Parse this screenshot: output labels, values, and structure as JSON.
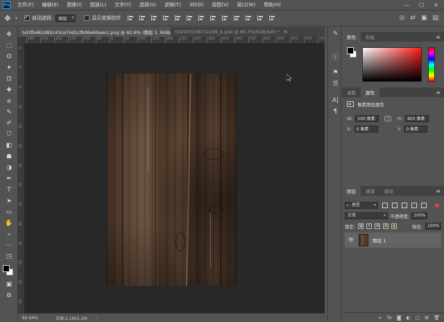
{
  "app": {
    "logo_text": "Ps"
  },
  "menu": {
    "items": [
      "文件(F)",
      "编辑(E)",
      "图像(I)",
      "图层(L)",
      "文字(Y)",
      "选择(S)",
      "滤镜(T)",
      "3D(D)",
      "视图(V)",
      "窗口(W)",
      "帮助(H)"
    ],
    "window_controls": [
      "—",
      "☐",
      "✕"
    ]
  },
  "options_bar": {
    "auto_select_label": "自动选择:",
    "auto_select_checked": true,
    "auto_select_target": "图层",
    "transform_controls_label": "显示变换控件",
    "transform_controls_checked": false,
    "right_icons": [
      "◎",
      "⇄",
      "▣",
      "▤"
    ]
  },
  "tabs": [
    {
      "label": "bd3fb482d82c43ce74d1cfb06e69aecc.png @ 82.6% (图层 1, RGB/8)",
      "close": "×",
      "active": true
    },
    {
      "label": "002003038732288_b.psd @ 66.7%(RGB/8#) *",
      "close": "×",
      "active": false
    }
  ],
  "rulers": {
    "h_ticks": [
      "300",
      "250",
      "200",
      "150",
      "100",
      "50",
      "0",
      "50",
      "100",
      "150",
      "200",
      "250",
      "300",
      "350",
      "400",
      "450",
      "500",
      "550",
      "600",
      "650",
      "700",
      "750"
    ],
    "v_ticks": [
      "5",
      "0",
      "5",
      "10",
      "15",
      "20",
      "25",
      "30",
      "35",
      "40",
      "45",
      "50",
      "55",
      "60"
    ]
  },
  "status": {
    "zoom": "82.64%",
    "doc": "文档:1.1M/1.1M",
    "arrow": "›"
  },
  "tools": [
    "✥",
    "⬚",
    "ʘ",
    "✦",
    "⊡",
    "✚",
    "⌀",
    "✎",
    "✐",
    "⛉",
    "◧",
    "☗",
    "◑",
    "✒",
    "T",
    "➤",
    "▭",
    "✋",
    "⌕",
    "···",
    "◳",
    "▣",
    "⧉"
  ],
  "strip_icons": [
    "✎",
    "ⓘ",
    "⚑",
    "☰",
    "A|",
    "¶"
  ],
  "color_panel": {
    "tabs": [
      "颜色",
      "色板"
    ],
    "menu": "≡",
    "fg_color": "#000000",
    "bg_color": "#ffffff"
  },
  "properties_panel": {
    "tabs": [
      "调整",
      "属性"
    ],
    "menu": "≡",
    "section_title": "像素图层属性",
    "w_label": "W:",
    "w_value": "500 像素",
    "link_icon": "∞",
    "h_label": "H:",
    "h_value": "800 像素",
    "x_label": "X:",
    "x_value": "0 像素",
    "y_label": "Y:",
    "y_value": "0 像素"
  },
  "layers_panel": {
    "tabs": [
      "图层",
      "通道",
      "路径"
    ],
    "menu": "≡",
    "kind_label": "类型",
    "blend_mode": "正常",
    "opacity_label": "不透明度:",
    "opacity_value": "100%",
    "lock_label": "锁定:",
    "fill_label": "填充:",
    "fill_value": "100%",
    "layers": [
      {
        "name": "图层 1",
        "visible_icon": "👁"
      }
    ],
    "footer_icons": [
      "∞",
      "fx",
      "◙",
      "◐",
      "▢",
      "⊞",
      "🗑"
    ]
  }
}
